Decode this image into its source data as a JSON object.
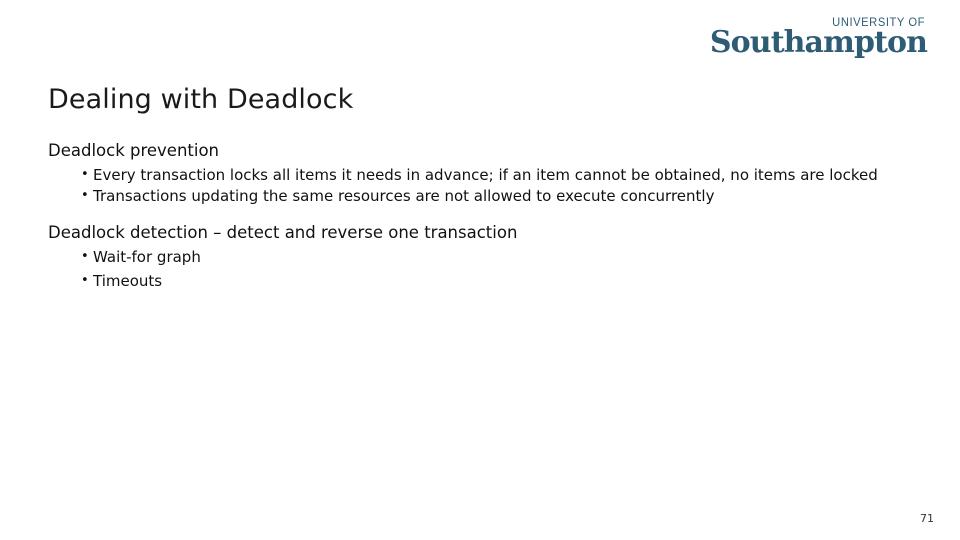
{
  "logo": {
    "top_line": "UNIVERSITY OF",
    "name": "Southampton",
    "color": "#2e5c75"
  },
  "slide": {
    "title": "Dealing with Deadlock",
    "page_number": "71",
    "text_color": "#111111",
    "background": "#ffffff",
    "sections": [
      {
        "heading": "Deadlock prevention",
        "bullet_marker": "•",
        "bullets": [
          "Every transaction locks all items it needs in advance; if an item cannot be obtained, no items are locked",
          "Transactions updating the same resources are not allowed to execute concurrently"
        ]
      },
      {
        "heading": "Deadlock detection – detect and reverse one transaction",
        "bullet_marker": "•",
        "bullets": [
          "Wait-for graph",
          "Timeouts"
        ]
      }
    ]
  }
}
